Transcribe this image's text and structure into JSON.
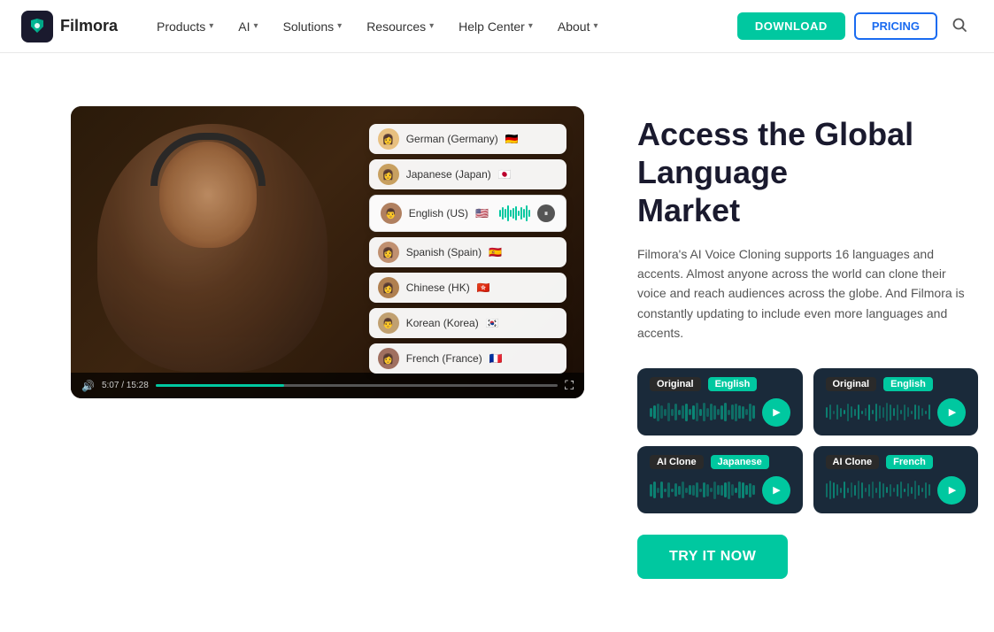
{
  "nav": {
    "logo_text": "Filmora",
    "items": [
      {
        "label": "Products",
        "has_dropdown": true
      },
      {
        "label": "AI",
        "has_dropdown": true
      },
      {
        "label": "Solutions",
        "has_dropdown": true
      },
      {
        "label": "Resources",
        "has_dropdown": true
      },
      {
        "label": "Help Center",
        "has_dropdown": true
      },
      {
        "label": "About",
        "has_dropdown": true
      }
    ],
    "download_label": "DOWNLOAD",
    "pricing_label": "PRICING"
  },
  "hero": {
    "heading_line1": "Access the Global Language",
    "heading_line2": "Market",
    "description": "Filmora's AI Voice Cloning supports 16 languages and accents. Almost anyone across the world can clone their voice and reach audiences across the globe. And Filmora is constantly updating to include even more languages and accents.",
    "languages": [
      {
        "name": "German (Germany)",
        "flag": "🇩🇪"
      },
      {
        "name": "Japanese (Japan)",
        "flag": "🇯🇵"
      },
      {
        "name": "English (US)",
        "flag": "🇺🇸",
        "active": true
      },
      {
        "name": "Spanish (Spain)",
        "flag": "🇪🇸"
      },
      {
        "name": "Chinese (HK)",
        "flag": "🇭🇰"
      },
      {
        "name": "Korean (Korea)",
        "flag": "🇰🇷"
      },
      {
        "name": "French (France)",
        "flag": "🇫🇷"
      }
    ],
    "audio_cards": [
      {
        "type": "Original",
        "lang_badge": "English",
        "position": "top-left"
      },
      {
        "type": "Original",
        "lang_badge": "English",
        "position": "top-right"
      },
      {
        "type": "AI Clone",
        "lang_badge": "Japanese",
        "position": "bottom-left"
      },
      {
        "type": "AI Clone",
        "lang_badge": "French",
        "position": "bottom-right"
      }
    ],
    "try_button": "TRY IT NOW",
    "video_time": "5:07 / 15:28"
  }
}
